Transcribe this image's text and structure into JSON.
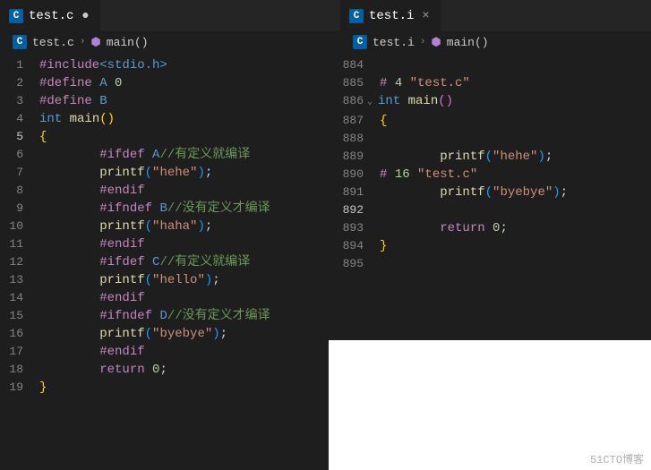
{
  "watermark": "51CTO博客",
  "left": {
    "tab": {
      "icon": "C",
      "name": "test.c",
      "dirty": true
    },
    "breadcrumb": {
      "icon": "C",
      "file": "test.c",
      "symbol_icon": "⬢",
      "symbol": "main()"
    },
    "lines": [
      {
        "n": "1",
        "indent": 0,
        "tokens": [
          [
            "hl-include",
            "#include"
          ],
          [
            "hl-macro",
            "<stdio.h>"
          ]
        ]
      },
      {
        "n": "2",
        "indent": 0,
        "tokens": [
          [
            "hl-define",
            "#define"
          ],
          [
            "",
            " "
          ],
          [
            "hl-macro",
            "A"
          ],
          [
            "",
            " "
          ],
          [
            "hl-num",
            "0"
          ]
        ]
      },
      {
        "n": "3",
        "indent": 0,
        "tokens": [
          [
            "hl-define",
            "#define"
          ],
          [
            "",
            " "
          ],
          [
            "hl-macro",
            "B"
          ]
        ]
      },
      {
        "n": "4",
        "indent": 0,
        "tokens": [
          [
            "hl-type",
            "int"
          ],
          [
            "",
            " "
          ],
          [
            "hl-func",
            "main"
          ],
          [
            "hl-brace",
            "("
          ],
          [
            "hl-brace",
            ")"
          ]
        ]
      },
      {
        "n": "5",
        "indent": 0,
        "current": true,
        "tokens": [
          [
            "hl-brace",
            "{"
          ]
        ]
      },
      {
        "n": "6",
        "indent": 2,
        "tokens": [
          [
            "hl-ifdef",
            "#ifdef"
          ],
          [
            "",
            " "
          ],
          [
            "hl-macro",
            "A"
          ],
          [
            "hl-comment",
            "//有定义就编译"
          ]
        ]
      },
      {
        "n": "7",
        "indent": 2,
        "tokens": [
          [
            "hl-func",
            "printf"
          ],
          [
            "hl-paren",
            "("
          ],
          [
            "hl-string",
            "\"hehe\""
          ],
          [
            "hl-paren",
            ")"
          ],
          [
            "hl-punct",
            ";"
          ]
        ]
      },
      {
        "n": "8",
        "indent": 2,
        "tokens": [
          [
            "hl-ifdef",
            "#endif"
          ]
        ]
      },
      {
        "n": "9",
        "indent": 2,
        "tokens": [
          [
            "hl-ifdef",
            "#ifndef"
          ],
          [
            "",
            " "
          ],
          [
            "hl-macro",
            "B"
          ],
          [
            "hl-comment",
            "//没有定义才编译"
          ]
        ]
      },
      {
        "n": "10",
        "indent": 2,
        "tokens": [
          [
            "hl-func",
            "printf"
          ],
          [
            "hl-paren",
            "("
          ],
          [
            "hl-string",
            "\"haha\""
          ],
          [
            "hl-paren",
            ")"
          ],
          [
            "hl-punct",
            ";"
          ]
        ]
      },
      {
        "n": "11",
        "indent": 2,
        "tokens": [
          [
            "hl-ifdef",
            "#endif"
          ]
        ]
      },
      {
        "n": "12",
        "indent": 2,
        "tokens": [
          [
            "hl-ifdef",
            "#ifdef"
          ],
          [
            "",
            " "
          ],
          [
            "hl-macro",
            "C"
          ],
          [
            "hl-comment",
            "//有定义就编译"
          ]
        ]
      },
      {
        "n": "13",
        "indent": 2,
        "tokens": [
          [
            "hl-func",
            "printf"
          ],
          [
            "hl-paren",
            "("
          ],
          [
            "hl-string",
            "\"hello\""
          ],
          [
            "hl-paren",
            ")"
          ],
          [
            "hl-punct",
            ";"
          ]
        ]
      },
      {
        "n": "14",
        "indent": 2,
        "tokens": [
          [
            "hl-ifdef",
            "#endif"
          ]
        ]
      },
      {
        "n": "15",
        "indent": 2,
        "tokens": [
          [
            "hl-ifdef",
            "#ifndef"
          ],
          [
            "",
            " "
          ],
          [
            "hl-macro",
            "D"
          ],
          [
            "hl-comment",
            "//没有定义才编译"
          ]
        ]
      },
      {
        "n": "16",
        "indent": 2,
        "tokens": [
          [
            "hl-func",
            "printf"
          ],
          [
            "hl-paren",
            "("
          ],
          [
            "hl-string",
            "\"byebye\""
          ],
          [
            "hl-paren",
            ")"
          ],
          [
            "hl-punct",
            ";"
          ]
        ]
      },
      {
        "n": "17",
        "indent": 2,
        "tokens": [
          [
            "hl-ifdef",
            "#endif"
          ]
        ]
      },
      {
        "n": "18",
        "indent": 2,
        "tokens": [
          [
            "hl-keyword",
            "return"
          ],
          [
            "",
            " "
          ],
          [
            "hl-num",
            "0"
          ],
          [
            "hl-punct",
            ";"
          ]
        ]
      },
      {
        "n": "19",
        "indent": 0,
        "tokens": [
          [
            "hl-brace",
            "}"
          ]
        ]
      }
    ]
  },
  "right": {
    "tab": {
      "icon": "C",
      "name": "test.i",
      "dirty": false
    },
    "breadcrumb": {
      "icon": "C",
      "file": "test.i",
      "symbol_icon": "⬢",
      "symbol": "main()"
    },
    "lines": [
      {
        "n": "884",
        "indent": 0,
        "tokens": []
      },
      {
        "n": "885",
        "indent": 0,
        "tokens": [
          [
            "hl-define",
            "#"
          ],
          [
            "",
            " "
          ],
          [
            "hl-num",
            "4"
          ],
          [
            "",
            " "
          ],
          [
            "hl-string",
            "\"test.c\""
          ]
        ]
      },
      {
        "n": "886",
        "indent": 0,
        "fold": true,
        "tokens": [
          [
            "hl-type",
            "int"
          ],
          [
            "",
            " "
          ],
          [
            "hl-func",
            "main"
          ],
          [
            "hl-paren2",
            "("
          ],
          [
            "hl-paren2",
            ")"
          ]
        ]
      },
      {
        "n": "887",
        "indent": 0,
        "tokens": [
          [
            "hl-brace",
            "{"
          ]
        ]
      },
      {
        "n": "888",
        "indent": 0,
        "tokens": []
      },
      {
        "n": "889",
        "indent": 2,
        "tokens": [
          [
            "hl-func",
            "printf"
          ],
          [
            "hl-paren",
            "("
          ],
          [
            "hl-string",
            "\"hehe\""
          ],
          [
            "hl-paren",
            ")"
          ],
          [
            "hl-punct",
            ";"
          ]
        ]
      },
      {
        "n": "890",
        "indent": 0,
        "tokens": [
          [
            "hl-define",
            "#"
          ],
          [
            "",
            " "
          ],
          [
            "hl-num",
            "16"
          ],
          [
            "",
            " "
          ],
          [
            "hl-string",
            "\"test.c\""
          ]
        ]
      },
      {
        "n": "891",
        "indent": 2,
        "tokens": [
          [
            "hl-func",
            "printf"
          ],
          [
            "hl-paren",
            "("
          ],
          [
            "hl-string",
            "\"byebye\""
          ],
          [
            "hl-paren",
            ")"
          ],
          [
            "hl-punct",
            ";"
          ]
        ]
      },
      {
        "n": "892",
        "indent": 0,
        "current": true,
        "tokens": []
      },
      {
        "n": "893",
        "indent": 2,
        "tokens": [
          [
            "hl-keyword",
            "return"
          ],
          [
            "",
            " "
          ],
          [
            "hl-num",
            "0"
          ],
          [
            "hl-punct",
            ";"
          ]
        ]
      },
      {
        "n": "894",
        "indent": 0,
        "tokens": [
          [
            "hl-brace",
            "}"
          ]
        ]
      },
      {
        "n": "895",
        "indent": 0,
        "tokens": []
      }
    ]
  }
}
